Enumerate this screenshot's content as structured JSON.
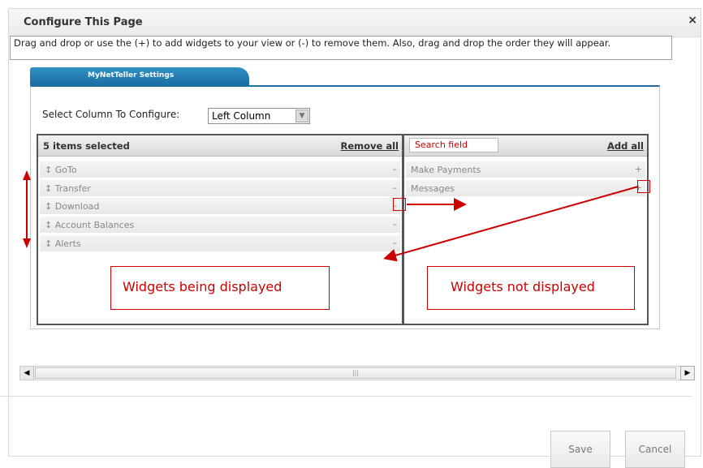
{
  "dialog": {
    "title": "Configure This Page",
    "close_label": "×",
    "help_text": "Drag and drop or use the (+) to add widgets to your view or (-) to remove them. Also, drag and drop the order they will appear.",
    "tab_label": "MyNetTeller Settings"
  },
  "config": {
    "select_label": "Select Column To Configure:",
    "select_value": "Left Column"
  },
  "left_list": {
    "header": "5 items selected",
    "action": "Remove all",
    "items": [
      {
        "label": "GoTo",
        "action": "–"
      },
      {
        "label": "Transfer",
        "action": "–"
      },
      {
        "label": "Download",
        "action": "–"
      },
      {
        "label": "Account Balances",
        "action": "–"
      },
      {
        "label": "Alerts",
        "action": "–"
      }
    ],
    "callout": "Widgets being displayed"
  },
  "right_list": {
    "search_placeholder": "Search field",
    "action": "Add all",
    "items": [
      {
        "label": "Make Payments",
        "action": "+"
      },
      {
        "label": "Messages",
        "action": "+"
      }
    ],
    "callout": "Widgets not displayed"
  },
  "footer": {
    "save_label": "Save",
    "cancel_label": "Cancel"
  },
  "colors": {
    "accent": "#1d6fa3",
    "annotation": "#cc0000"
  }
}
